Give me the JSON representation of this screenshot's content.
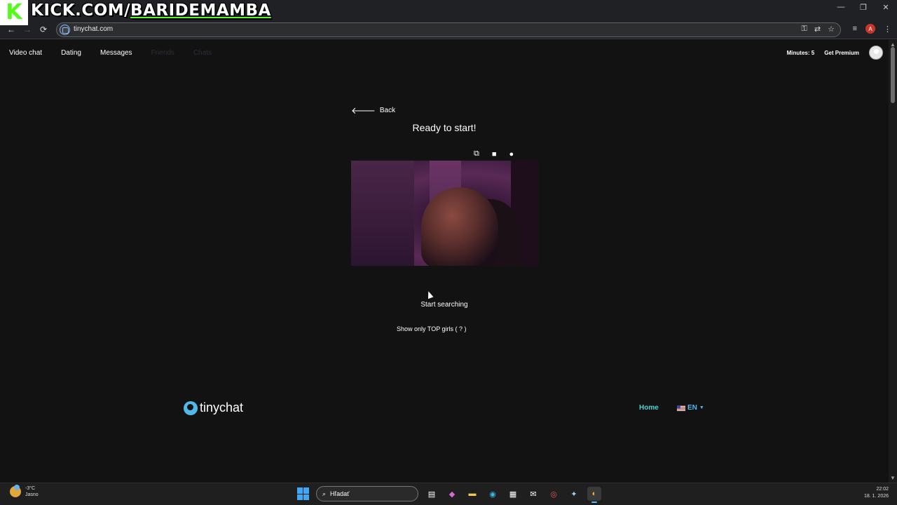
{
  "overlay": {
    "logo_letter": "K",
    "text_prefix": "KICK.COM/",
    "text_name": "BARIDEMAMBA"
  },
  "window": {
    "minimize": "—",
    "maximize": "❐",
    "close": "✕"
  },
  "browser": {
    "back_glyph": "←",
    "forward_glyph": "→",
    "reload_glyph": "⟳",
    "url": "tinychat.com",
    "omni_icons": [
      "⚿",
      "⇄",
      "☆"
    ],
    "toolbar_icons": [
      "≡",
      "⋮"
    ],
    "profile_initial": "A"
  },
  "nav": {
    "items": [
      "Video chat",
      "Dating",
      "Messages"
    ],
    "faded_items": [
      "Friends",
      "Chats"
    ]
  },
  "account": {
    "minutes": "Minutes: 5",
    "premium": "Get Premium"
  },
  "main": {
    "back": "Back",
    "back_glyph": "🡐",
    "heading": "Ready to start!",
    "camera_controls": {
      "mirror": "⧉",
      "camera": "■",
      "mic": "●"
    },
    "start": "Start searching",
    "top_girls": "Show only TOP girls ( ? )"
  },
  "footer": {
    "brand": "tinychat",
    "home": "Home",
    "language": "EN",
    "lang_caret": "▼"
  },
  "taskbar": {
    "temperature": "-3°C",
    "condition": "Jasno",
    "search_placeholder": "Hľadať",
    "search_glyph": "⌕",
    "apps": [
      "▤",
      "◆",
      "▬",
      "◉",
      "▦",
      "✉",
      "◎",
      "✦",
      "◐"
    ],
    "time": "22:02",
    "date": "18. 1. 2026"
  },
  "colors": {
    "accent": "#4fb9ea",
    "home_link": "#4fd1d9",
    "kick_green": "#53fc18",
    "background": "#121212"
  }
}
